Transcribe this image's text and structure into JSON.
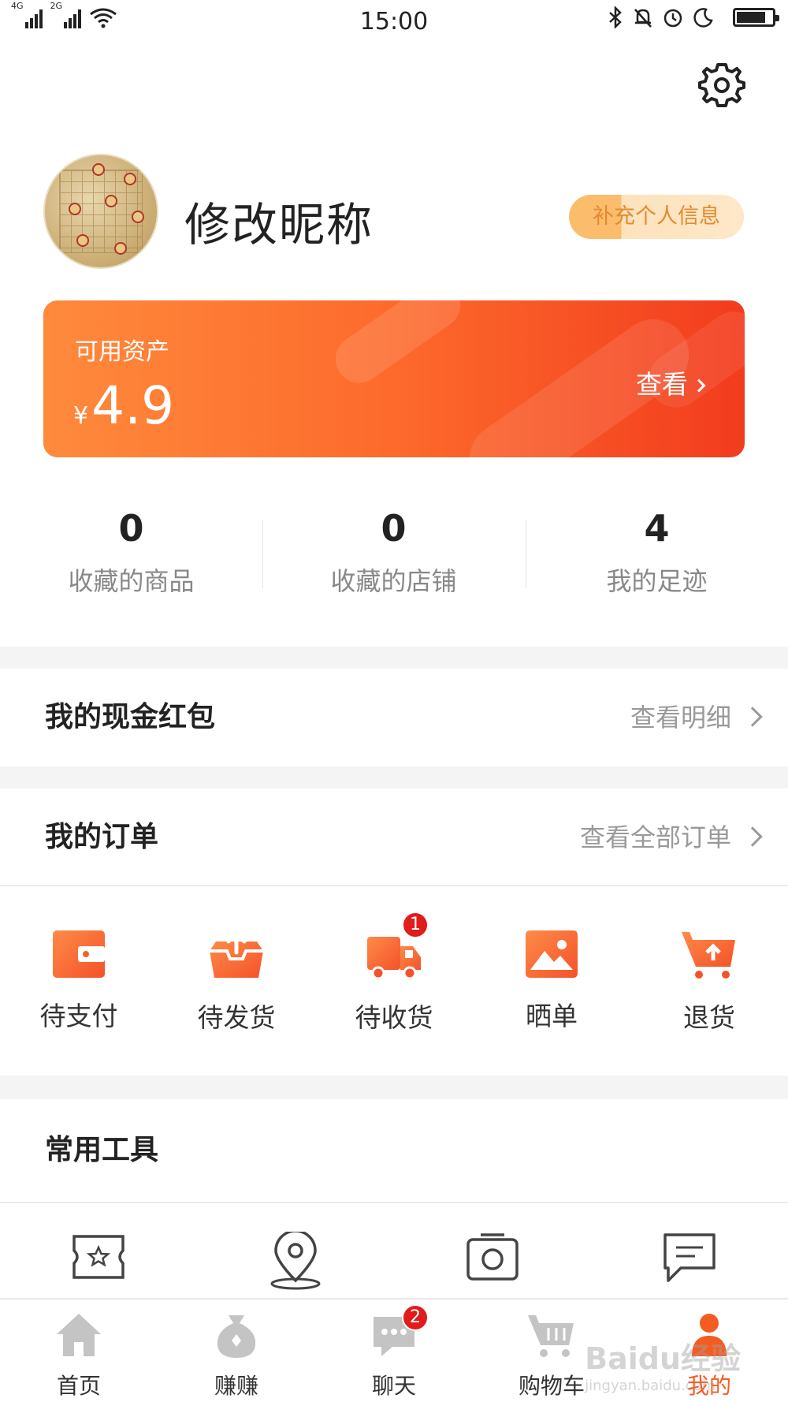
{
  "status_bar": {
    "network_1": "4G",
    "network_2": "2G",
    "time": "15:00",
    "icons": [
      "wifi-icon",
      "bluetooth-icon",
      "bell-muted-icon",
      "alarm-icon",
      "moon-icon",
      "battery-icon"
    ]
  },
  "header": {
    "settings_icon": "gear-icon"
  },
  "profile": {
    "nickname": "修改昵称",
    "supplement_button": "补充个人信息"
  },
  "assets": {
    "label": "可用资产",
    "currency": "¥",
    "amount": "4.9",
    "view_label": "查看"
  },
  "stats": [
    {
      "value": "0",
      "label": "收藏的商品"
    },
    {
      "value": "0",
      "label": "收藏的店铺"
    },
    {
      "value": "4",
      "label": "我的足迹"
    }
  ],
  "red_packet": {
    "title": "我的现金红包",
    "link": "查看明细"
  },
  "orders": {
    "title": "我的订单",
    "link": "查看全部订单",
    "items": [
      {
        "label": "待支付",
        "icon": "wallet-icon"
      },
      {
        "label": "待发货",
        "icon": "box-upload-icon"
      },
      {
        "label": "待收货",
        "icon": "truck-icon",
        "badge": "1"
      },
      {
        "label": "晒单",
        "icon": "image-icon"
      },
      {
        "label": "退货",
        "icon": "cart-return-icon"
      }
    ]
  },
  "tools": {
    "title": "常用工具",
    "icons": [
      "coupon-icon",
      "location-icon",
      "camera-icon",
      "message-icon"
    ]
  },
  "tabbar": {
    "items": [
      {
        "label": "首页",
        "icon": "home-icon"
      },
      {
        "label": "赚赚",
        "icon": "money-bag-icon"
      },
      {
        "label": "聊天",
        "icon": "chat-icon",
        "badge": "2"
      },
      {
        "label": "购物车",
        "icon": "cart-icon"
      },
      {
        "label": "我的",
        "icon": "user-icon",
        "active": true
      }
    ]
  },
  "colors": {
    "accent": "#f45c22",
    "card_start": "#fe8a3c",
    "card_end": "#f23c1e",
    "badge": "#e21b1b"
  },
  "watermark": {
    "text": "Baidu经验",
    "subtext": "jingyan.baidu.com"
  }
}
